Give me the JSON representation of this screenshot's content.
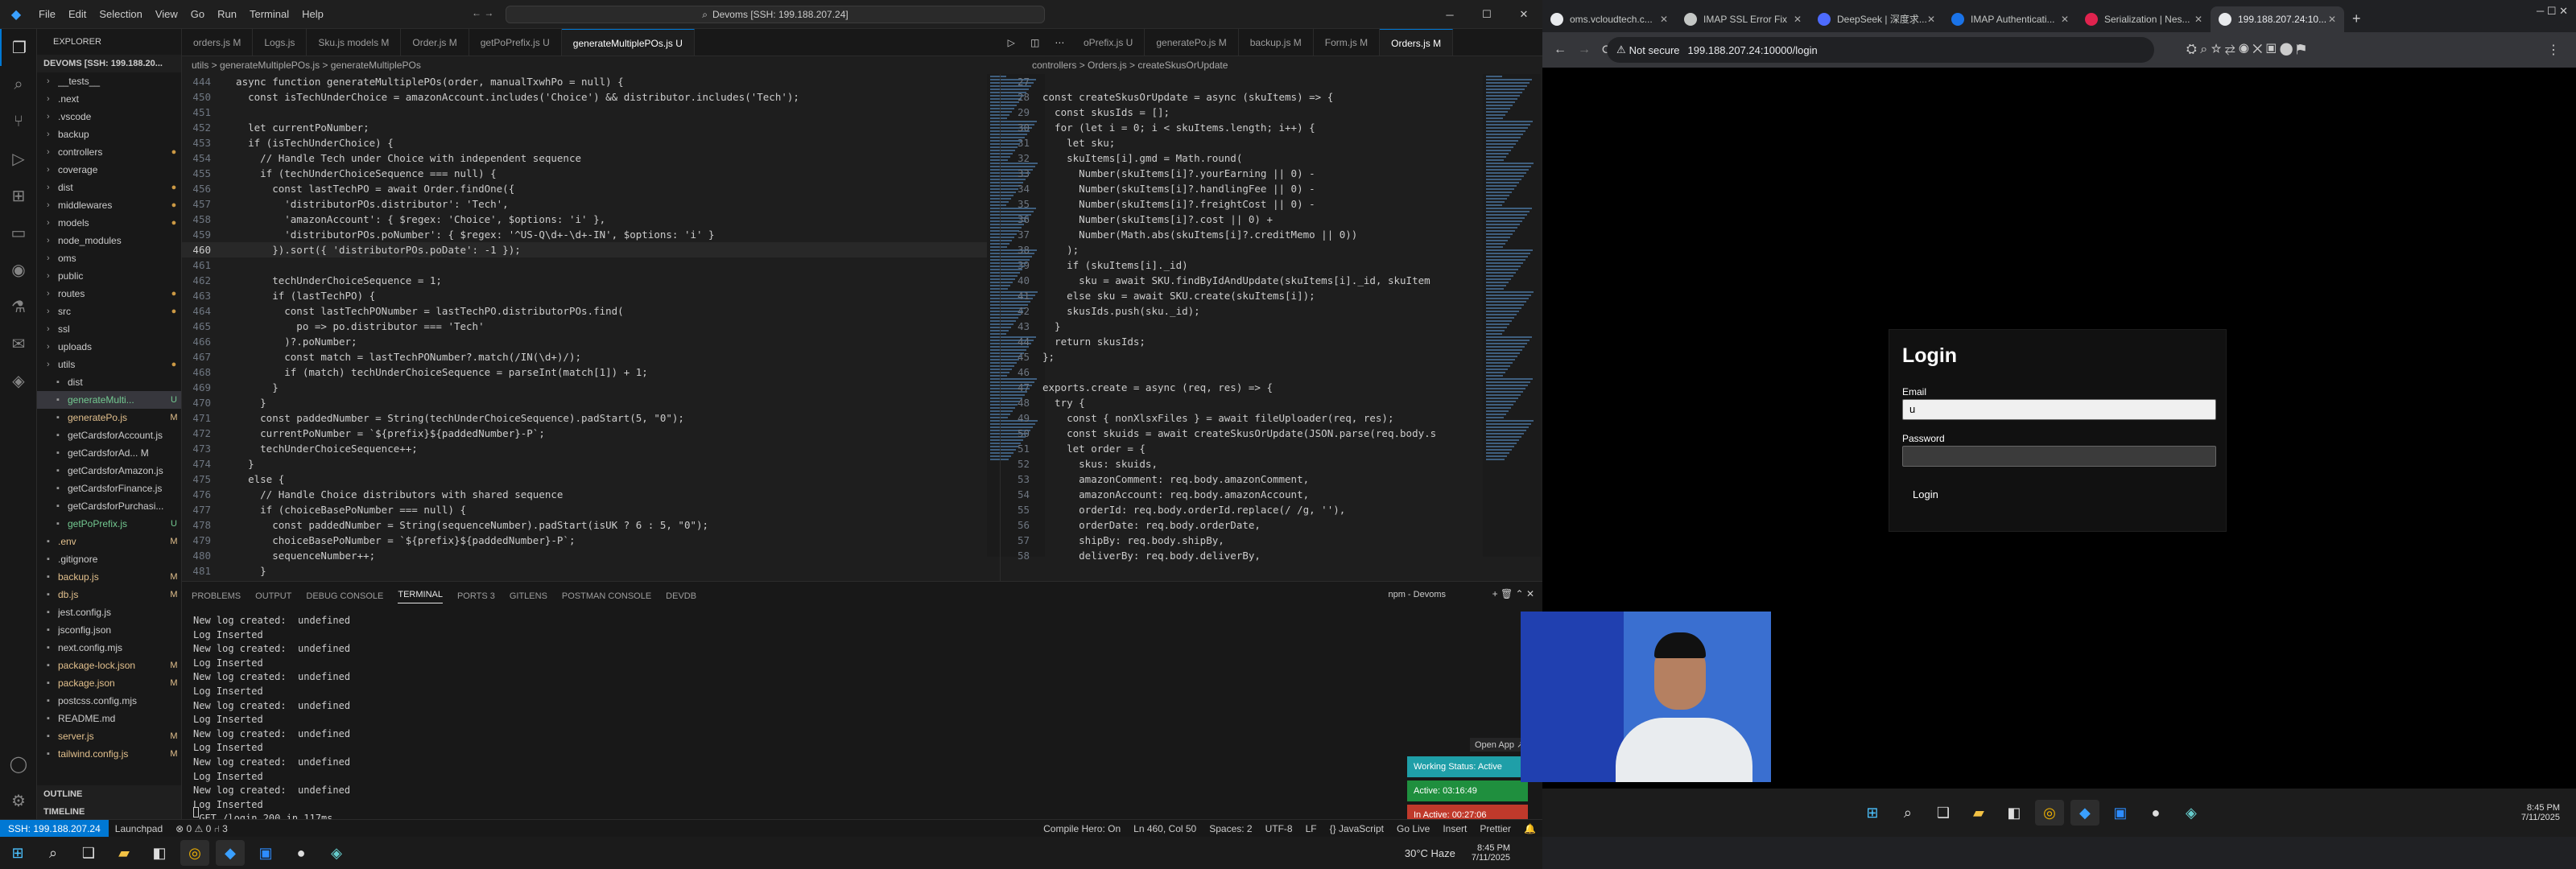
{
  "vscode": {
    "menu": [
      "File",
      "Edit",
      "Selection",
      "View",
      "Go",
      "Run",
      "Terminal",
      "Help"
    ],
    "command_center": "Devoms [SSH: 199.188.207.24]",
    "explorer_title": "EXPLORER",
    "workspace": "DEVOMS [SSH: 199.188.20...",
    "files": [
      {
        "name": "__tests__",
        "badge": ""
      },
      {
        "name": ".next",
        "badge": ""
      },
      {
        "name": ".vscode",
        "badge": ""
      },
      {
        "name": "backup",
        "badge": ""
      },
      {
        "name": "controllers",
        "badge": "●"
      },
      {
        "name": "coverage",
        "badge": ""
      },
      {
        "name": "dist",
        "badge": "●"
      },
      {
        "name": "middlewares",
        "badge": "●"
      },
      {
        "name": "models",
        "badge": "●"
      },
      {
        "name": "node_modules",
        "badge": ""
      },
      {
        "name": "oms",
        "badge": ""
      },
      {
        "name": "public",
        "badge": ""
      },
      {
        "name": "routes",
        "badge": "●"
      },
      {
        "name": "src",
        "badge": "●"
      },
      {
        "name": "ssl",
        "badge": ""
      },
      {
        "name": "uploads",
        "badge": ""
      },
      {
        "name": "utils",
        "badge": "●"
      },
      {
        "name": "dist",
        "badge": ""
      },
      {
        "name": "generateMulti...",
        "badge": "U"
      },
      {
        "name": "generatePo.js",
        "badge": "M"
      },
      {
        "name": "getCardsforAccount.js",
        "badge": ""
      },
      {
        "name": "getCardsforAd... M",
        "badge": ""
      },
      {
        "name": "getCardsforAmazon.js",
        "badge": ""
      },
      {
        "name": "getCardsforFinance.js",
        "badge": ""
      },
      {
        "name": "getCardsforPurchasi...",
        "badge": ""
      },
      {
        "name": "getPoPrefix.js",
        "badge": "U"
      },
      {
        "name": ".env",
        "badge": "M"
      },
      {
        "name": ".gitignore",
        "badge": ""
      },
      {
        "name": "backup.js",
        "badge": "M"
      },
      {
        "name": "db.js",
        "badge": "M"
      },
      {
        "name": "jest.config.js",
        "badge": ""
      },
      {
        "name": "jsconfig.json",
        "badge": ""
      },
      {
        "name": "next.config.mjs",
        "badge": ""
      },
      {
        "name": "package-lock.json",
        "badge": "M"
      },
      {
        "name": "package.json",
        "badge": "M"
      },
      {
        "name": "postcss.config.mjs",
        "badge": ""
      },
      {
        "name": "README.md",
        "badge": ""
      },
      {
        "name": "server.js",
        "badge": "M"
      },
      {
        "name": "tailwind.config.js",
        "badge": "M"
      }
    ],
    "outline": "OUTLINE",
    "timeline": "TIMELINE",
    "tabs_left": [
      "orders.js M",
      "Logs.js",
      "Sku.js models M",
      "Order.js M",
      "getPoPrefix.js U",
      "generateMultiplePOs.js U"
    ],
    "tabs_right": [
      "oPrefix.js U",
      "generatePo.js M",
      "backup.js M",
      "Form.js M",
      "Orders.js M"
    ],
    "breadcrumb_left": "utils > generateMultiplePOs.js > generateMultiplePOs",
    "breadcrumb_right": "controllers > Orders.js > createSkusOrUpdate",
    "left_code": [
      [
        "444",
        "  async function generateMultiplePOs(order, manualTxwhPo = null) {"
      ],
      [
        "450",
        "    const isTechUnderChoice = amazonAccount.includes('Choice') && distributor.includes('Tech');"
      ],
      [
        "451",
        ""
      ],
      [
        "452",
        "    let currentPoNumber;"
      ],
      [
        "453",
        "    if (isTechUnderChoice) {"
      ],
      [
        "454",
        "      // Handle Tech under Choice with independent sequence"
      ],
      [
        "455",
        "      if (techUnderChoiceSequence === null) {"
      ],
      [
        "456",
        "        const lastTechPO = await Order.findOne({"
      ],
      [
        "457",
        "          'distributorPOs.distributor': 'Tech',"
      ],
      [
        "458",
        "          'amazonAccount': { $regex: 'Choice', $options: 'i' },"
      ],
      [
        "459",
        "          'distributorPOs.poNumber': { $regex: '^US-Q\\d+-\\d+-IN', $options: 'i' }"
      ],
      [
        "460",
        "        }).sort({ 'distributorPOs.poDate': -1 });"
      ],
      [
        "461",
        ""
      ],
      [
        "462",
        "        techUnderChoiceSequence = 1;"
      ],
      [
        "463",
        "        if (lastTechPO) {"
      ],
      [
        "464",
        "          const lastTechPONumber = lastTechPO.distributorPOs.find("
      ],
      [
        "465",
        "            po => po.distributor === 'Tech'"
      ],
      [
        "466",
        "          )?.poNumber;"
      ],
      [
        "467",
        "          const match = lastTechPONumber?.match(/IN(\\d+)/);"
      ],
      [
        "468",
        "          if (match) techUnderChoiceSequence = parseInt(match[1]) + 1;"
      ],
      [
        "469",
        "        }"
      ],
      [
        "470",
        "      }"
      ],
      [
        "471",
        "      const paddedNumber = String(techUnderChoiceSequence).padStart(5, \"0\");"
      ],
      [
        "472",
        "      currentPoNumber = `${prefix}${paddedNumber}-P`;"
      ],
      [
        "473",
        "      techUnderChoiceSequence++;"
      ],
      [
        "474",
        "    }"
      ],
      [
        "475",
        "    else {"
      ],
      [
        "476",
        "      // Handle Choice distributors with shared sequence"
      ],
      [
        "477",
        "      if (choiceBasePoNumber === null) {"
      ],
      [
        "478",
        "        const paddedNumber = String(sequenceNumber).padStart(isUK ? 6 : 5, \"0\");"
      ],
      [
        "479",
        "        choiceBasePoNumber = `${prefix}${paddedNumber}-P`;"
      ],
      [
        "480",
        "        sequenceNumber++;"
      ],
      [
        "481",
        "      }"
      ]
    ],
    "right_code": [
      [
        "27",
        ""
      ],
      [
        "28",
        "const createSkusOrUpdate = async (skuItems) => {"
      ],
      [
        "29",
        "  const skusIds = [];"
      ],
      [
        "30",
        "  for (let i = 0; i < skuItems.length; i++) {"
      ],
      [
        "31",
        "    let sku;"
      ],
      [
        "32",
        "    skuItems[i].gmd = Math.round("
      ],
      [
        "33",
        "      Number(skuItems[i]?.yourEarning || 0) -"
      ],
      [
        "34",
        "      Number(skuItems[i]?.handlingFee || 0) -"
      ],
      [
        "35",
        "      Number(skuItems[i]?.freightCost || 0) -"
      ],
      [
        "36",
        "      Number(skuItems[i]?.cost || 0) +"
      ],
      [
        "37",
        "      Number(Math.abs(skuItems[i]?.creditMemo || 0))"
      ],
      [
        "38",
        "    );"
      ],
      [
        "39",
        "    if (skuItems[i]._id)"
      ],
      [
        "40",
        "      sku = await SKU.findByIdAndUpdate(skuItems[i]._id, skuItem"
      ],
      [
        "41",
        "    else sku = await SKU.create(skuItems[i]);"
      ],
      [
        "42",
        "    skusIds.push(sku._id);"
      ],
      [
        "43",
        "  }"
      ],
      [
        "44",
        "  return skusIds;"
      ],
      [
        "45",
        "};"
      ],
      [
        "46",
        ""
      ],
      [
        "47",
        "exports.create = async (req, res) => {"
      ],
      [
        "48",
        "  try {"
      ],
      [
        "49",
        "    const { nonXlsxFiles } = await fileUploader(req, res);"
      ],
      [
        "50",
        "    const skuids = await createSkusOrUpdate(JSON.parse(req.body.s"
      ],
      [
        "51",
        "    let order = {"
      ],
      [
        "52",
        "      skus: skuids,"
      ],
      [
        "53",
        "      amazonComment: req.body.amazonComment,"
      ],
      [
        "54",
        "      amazonAccount: req.body.amazonAccount,"
      ],
      [
        "55",
        "      orderId: req.body.orderId.replace(/ /g, ''),"
      ],
      [
        "56",
        "      orderDate: req.body.orderDate,"
      ],
      [
        "57",
        "      shipBy: req.body.shipBy,"
      ],
      [
        "58",
        "      deliverBy: req.body.deliverBy,"
      ]
    ],
    "panel_tabs": [
      "PROBLEMS",
      "OUTPUT",
      "DEBUG CONSOLE",
      "TERMINAL",
      "PORTS 3",
      "GITLENS",
      "POSTMAN CONSOLE",
      "DEVDB"
    ],
    "terminal_title": "npm - Devoms",
    "terminal_lines": [
      "New log created:  undefined",
      "Log Inserted",
      "New log created:  undefined",
      "Log Inserted",
      "New log created:  undefined",
      "Log Inserted",
      "New log created:  undefined",
      "Log Inserted",
      "New log created:  undefined",
      "Log Inserted",
      "New log created:  undefined",
      "Log Inserted",
      "New log created:  undefined",
      "Log Inserted",
      " GET /login 200 in 117ms"
    ],
    "open_app": "Open App ↗",
    "widgets": {
      "working": "Working Status: Active",
      "active": "Active: 03:16:49",
      "inactive": "In Active: 00:27:06"
    },
    "status": {
      "remote": "SSH: 199.188.207.24",
      "branch": "Launchpad",
      "errors": "⊗ 0  ⚠ 0  ⑁ 3",
      "compile": "Compile Hero: On",
      "position": "Ln 460, Col 50",
      "spaces": "Spaces: 2",
      "encoding": "UTF-8",
      "eol": "LF",
      "lang": "{} JavaScript",
      "golive": "Go Live",
      "insert": "Insert",
      "prettier": "Prettier"
    },
    "taskbar": {
      "weather": "30°C  Haze",
      "time": "8:45 PM",
      "date": "7/11/2025"
    }
  },
  "chrome": {
    "tabs": [
      "oms.vcloudtech.c...",
      "IMAP SSL Error Fix",
      "DeepSeek | 深度求...",
      "IMAP Authenticati...",
      "Serialization | Nes...",
      "199.188.207.24:10..."
    ],
    "tab_colors": [
      "#e8eaed",
      "#c4c7c5",
      "#4d6bfe",
      "#1a73e8",
      "#e0234e",
      "#e8eaed"
    ],
    "not_secure": "Not secure",
    "url": "199.188.207.24:10000/login",
    "login": {
      "title": "Login",
      "email_label": "Email",
      "email_value": "u",
      "password_label": "Password",
      "password_value": "",
      "button": "Login"
    },
    "taskbar": {
      "time": "8:45 PM",
      "date": "7/11/2025"
    }
  }
}
